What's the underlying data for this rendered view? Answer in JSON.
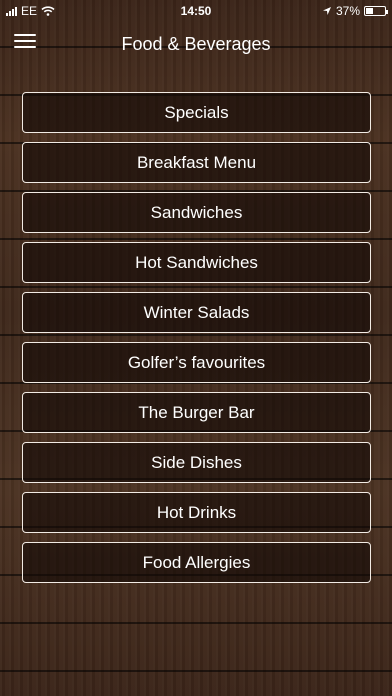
{
  "status_bar": {
    "carrier": "EE",
    "time": "14:50",
    "battery_percent": "37%",
    "battery_level": 0.37,
    "icons": [
      "signal-icon",
      "wifi-icon",
      "location-icon",
      "battery-icon"
    ]
  },
  "header": {
    "title": "Food & Beverages",
    "menu_icon": "hamburger-icon"
  },
  "menu": {
    "items": [
      {
        "label": "Specials"
      },
      {
        "label": "Breakfast Menu"
      },
      {
        "label": "Sandwiches"
      },
      {
        "label": "Hot Sandwiches"
      },
      {
        "label": "Winter Salads"
      },
      {
        "label": "Golfer’s favourites"
      },
      {
        "label": "The Burger Bar"
      },
      {
        "label": "Side Dishes"
      },
      {
        "label": "Hot Drinks"
      },
      {
        "label": "Food Allergies"
      }
    ]
  },
  "colors": {
    "button_border": "#f2ebe4",
    "text": "#ffffff",
    "wood_dark": "#3a2418"
  }
}
